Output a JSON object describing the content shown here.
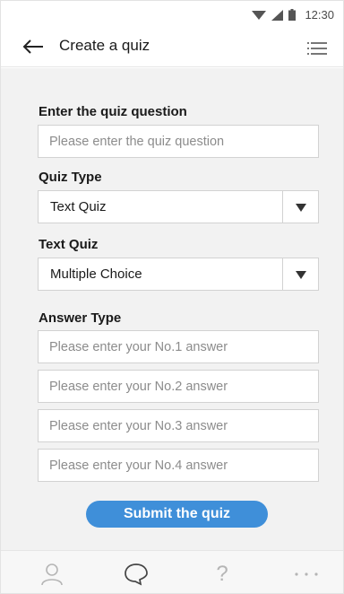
{
  "status_bar": {
    "time": "12:30",
    "icons": [
      "wifi-icon",
      "signal-icon",
      "battery-icon"
    ]
  },
  "app_bar": {
    "title": "Create a quiz",
    "back_icon": "arrow-left-icon",
    "menu_icon": "list-menu-icon"
  },
  "form": {
    "question_label": "Enter the quiz question",
    "question_placeholder": "Please enter the quiz question",
    "quiz_type_label": "Quiz Type",
    "quiz_type_value": "Text Quiz",
    "text_quiz_label": "Text Quiz",
    "text_quiz_value": "Multiple Choice",
    "answer_type_label": "Answer Type",
    "answers": [
      {
        "placeholder": "Please enter your No.1 answer"
      },
      {
        "placeholder": "Please enter your No.2 answer"
      },
      {
        "placeholder": "Please enter your No.3 answer"
      },
      {
        "placeholder": "Please enter your No.4 answer"
      }
    ],
    "submit_label": "Submit the quiz"
  },
  "bottom_nav": {
    "items": [
      {
        "icon": "person-icon"
      },
      {
        "icon": "chat-bubble-icon"
      },
      {
        "icon": "help-icon",
        "glyph": "?"
      },
      {
        "icon": "more-icon"
      }
    ]
  },
  "colors": {
    "accent": "#3f8fd9",
    "background": "#f2f2f2",
    "icon_gray": "#b5b5b5"
  }
}
